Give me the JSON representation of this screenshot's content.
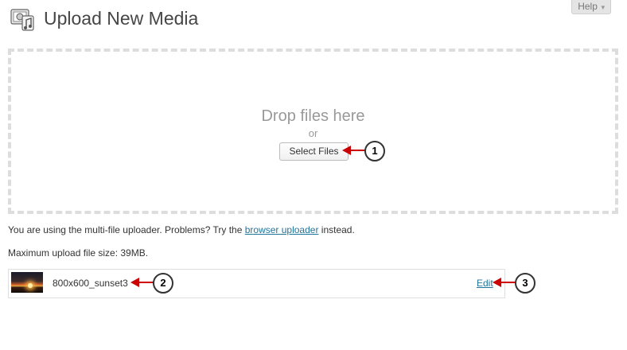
{
  "header": {
    "title": "Upload New Media",
    "icon": "media-library-icon",
    "help_label": "Help",
    "help_arrow": "▼"
  },
  "dropzone": {
    "drop_text": "Drop files here",
    "or_text": "or",
    "select_button": "Select Files"
  },
  "info": {
    "uploader_prefix": "You are using the multi-file uploader. Problems? Try the ",
    "uploader_link": "browser uploader",
    "uploader_suffix": " instead.",
    "max_size": "Maximum upload file size: 39MB."
  },
  "media_item": {
    "filename": "800x600_sunset3",
    "edit_label": "Edit"
  },
  "callouts": {
    "one": "1",
    "two": "2",
    "three": "3"
  },
  "colors": {
    "link": "#21759b",
    "callout_arrow": "#cc0000",
    "dropzone_border": "#dddddd"
  }
}
